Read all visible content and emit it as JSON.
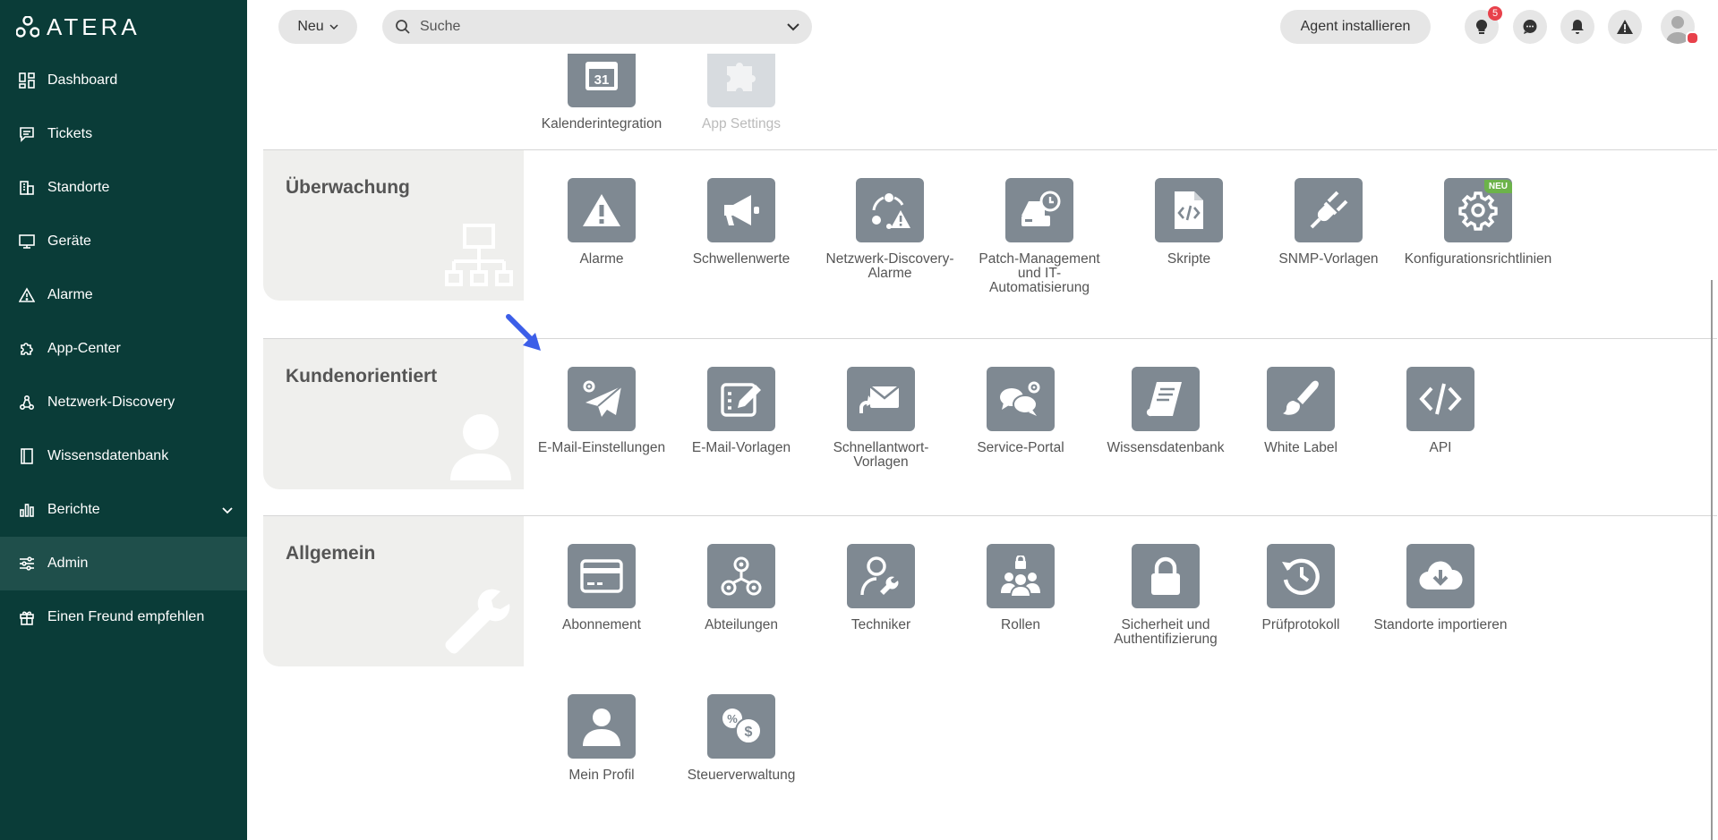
{
  "sidebar": {
    "logo_text": "ATERA",
    "items": [
      {
        "label": "Dashboard",
        "icon": "dashboard-icon"
      },
      {
        "label": "Tickets",
        "icon": "ticket-icon"
      },
      {
        "label": "Standorte",
        "icon": "building-icon"
      },
      {
        "label": "Geräte",
        "icon": "monitor-icon"
      },
      {
        "label": "Alarme",
        "icon": "warning-icon"
      },
      {
        "label": "App-Center",
        "icon": "puzzle-icon"
      },
      {
        "label": "Netzwerk-Discovery",
        "icon": "network-icon"
      },
      {
        "label": "Wissensdatenbank",
        "icon": "book-icon"
      },
      {
        "label": "Berichte",
        "icon": "chart-icon"
      },
      {
        "label": "Admin",
        "icon": "sliders-icon"
      },
      {
        "label": "Einen Freund empfehlen",
        "icon": "gift-icon"
      }
    ],
    "active_item": "Admin"
  },
  "topbar": {
    "new_label": "Neu",
    "search_placeholder": "Suche",
    "agent_label": "Agent installieren",
    "tips_badge": "5"
  },
  "sections": {
    "top": {
      "tiles": [
        {
          "label": "Kalenderintegration",
          "icon": "calendar-icon"
        },
        {
          "label": "App Settings",
          "icon": "puzzle-icon",
          "disabled": true
        }
      ]
    },
    "monitoring": {
      "title": "Überwachung",
      "tiles": [
        {
          "label": "Alarme",
          "icon": "warning-icon"
        },
        {
          "label": "Schwellenwerte",
          "icon": "megaphone-icon"
        },
        {
          "label": "Netzwerk-Discovery-Alarme",
          "icon": "network-alert-icon"
        },
        {
          "label": "Patch-Management und IT-Automatisierung",
          "icon": "patch-icon"
        },
        {
          "label": "Skripte",
          "icon": "script-icon"
        },
        {
          "label": "SNMP-Vorlagen",
          "icon": "plug-icon"
        },
        {
          "label": "Konfigurationsrichtlinien",
          "icon": "gear-icon",
          "tag": "NEU"
        }
      ]
    },
    "customer": {
      "title": "Kundenorientiert",
      "tiles": [
        {
          "label": "E-Mail-Einstellungen",
          "icon": "mail-settings-icon"
        },
        {
          "label": "E-Mail-Vorlagen",
          "icon": "mail-template-icon"
        },
        {
          "label": "Schnellantwort-Vorlagen",
          "icon": "quick-reply-icon"
        },
        {
          "label": "Service-Portal",
          "icon": "chat-gear-icon"
        },
        {
          "label": "Wissensdatenbank",
          "icon": "book-icon"
        },
        {
          "label": "White Label",
          "icon": "brush-icon"
        },
        {
          "label": "API",
          "icon": "code-icon"
        }
      ]
    },
    "general": {
      "title": "Allgemein",
      "tiles": [
        {
          "label": "Abonnement",
          "icon": "card-icon"
        },
        {
          "label": "Abteilungen",
          "icon": "org-icon"
        },
        {
          "label": "Techniker",
          "icon": "technician-icon"
        },
        {
          "label": "Rollen",
          "icon": "roles-icon"
        },
        {
          "label": "Sicherheit und Authentifizierung",
          "icon": "lock-icon"
        },
        {
          "label": "Prüfprotokoll",
          "icon": "history-icon"
        },
        {
          "label": "Standorte importieren",
          "icon": "cloud-download-icon"
        },
        {
          "label": "Mein Profil",
          "icon": "user-icon"
        },
        {
          "label": "Steuerverwaltung",
          "icon": "tax-icon"
        }
      ]
    }
  },
  "colors": {
    "sidebar": "#0a3c38",
    "tile": "#7f8992",
    "accent": "#3c5ee8",
    "badge": "#e8414b"
  }
}
